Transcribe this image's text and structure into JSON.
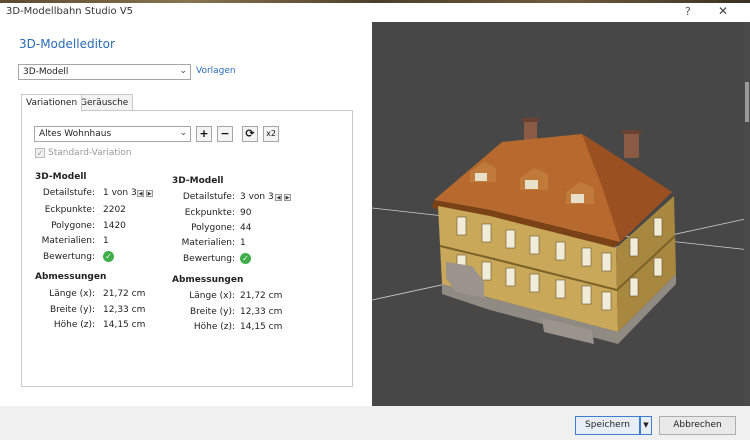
{
  "window": {
    "title": "3D-Modellbahn Studio V5",
    "help": "?",
    "close": "✕"
  },
  "editor": {
    "heading": "3D-Modelleditor",
    "mode_select": "3D-Modell",
    "vorlagen_link": "Vorlagen",
    "tabs": [
      "Variationen",
      "Geräusche"
    ],
    "variation_select": "Altes Wohnhaus",
    "buttons": {
      "add": "+",
      "remove": "−",
      "refresh": "⟳",
      "x2": "x2"
    },
    "standard_variation": "Standard-Variation",
    "left_model": {
      "title": "3D-Modell",
      "labels": [
        "Detailstufe:",
        "Eckpunkte:",
        "Polygone:",
        "Materialien:",
        "Bewertung:"
      ],
      "detailstufe": "1 von 3",
      "eckpunkte": "2202",
      "polygone": "1420",
      "materialien": "1"
    },
    "left_dims": {
      "title": "Abmessungen",
      "labels": [
        "Länge (x):",
        "Breite (y):",
        "Höhe (z):"
      ],
      "values": [
        "21,72 cm",
        "12,33 cm",
        "14,15 cm"
      ]
    },
    "right_model": {
      "title": "3D-Modell",
      "labels": [
        "Detailstufe:",
        "Eckpunkte:",
        "Polygone:",
        "Materialien:",
        "Bewertung:"
      ],
      "detailstufe": "3 von 3",
      "eckpunkte": "90",
      "polygone": "44",
      "materialien": "1"
    },
    "right_dims": {
      "title": "Abmessungen",
      "labels": [
        "Länge (x):",
        "Breite (y):",
        "Höhe (z):"
      ],
      "values": [
        "21,72 cm",
        "12,33 cm",
        "14,15 cm"
      ]
    }
  },
  "footer": {
    "save": "Speichern",
    "cancel": "Abbrechen"
  },
  "colors": {
    "accent": "#2a6cb8",
    "viewport_bg": "#474747",
    "ok_green": "#3fae49"
  }
}
